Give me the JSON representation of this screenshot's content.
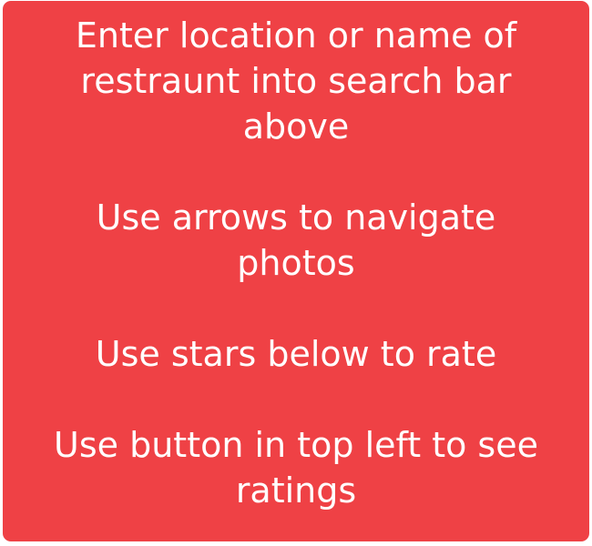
{
  "colors": {
    "card_background": "#ef4145",
    "text": "#ffffff"
  },
  "instructions": {
    "search": {
      "line1": "Enter location or name of",
      "line2": "restraunt into search bar",
      "line3": "above"
    },
    "navigate": {
      "line1": "Use arrows to navigate",
      "line2": "photos"
    },
    "rate": {
      "line1": "Use stars below to rate"
    },
    "ratings": {
      "line1": "Use button in top left to see",
      "line2": "ratings"
    }
  }
}
